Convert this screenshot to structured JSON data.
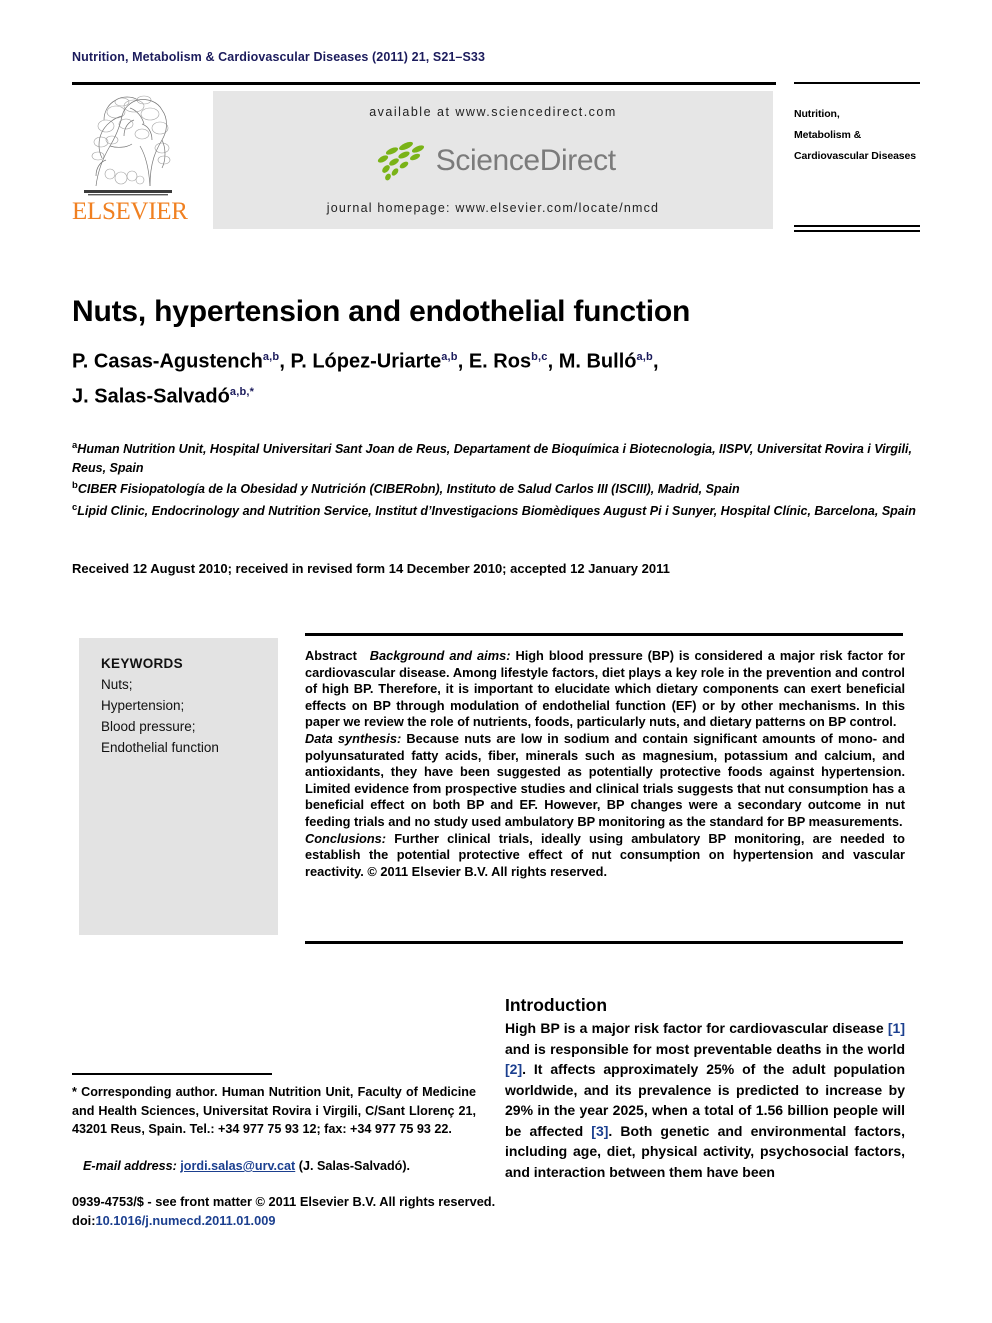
{
  "running_head": "Nutrition, Metabolism & Cardiovascular Diseases (2011) 21, S21–S33",
  "masthead": {
    "publisher_name": "ELSEVIER",
    "available_at": "available at www.sciencedirect.com",
    "sciencedirect_wordmark": "ScienceDirect",
    "journal_homepage": "journal homepage: www.elsevier.com/locate/nmcd",
    "journal_title_line1": "Nutrition,",
    "journal_title_line2": "Metabolism &",
    "journal_title_line3": "Cardiovascular Diseases",
    "colors": {
      "elsevier_orange": "#f08021",
      "sciencedirect_green": "#7ab317",
      "sciencedirect_grey": "#7b7b7b",
      "band_grey": "#e6e6e6"
    }
  },
  "article": {
    "title": "Nuts, hypertension and endothelial function",
    "authors_line1_parts": [
      {
        "name": "P. Casas-Agustench",
        "sup": "a,b",
        "sep": ", "
      },
      {
        "name": "P. López-Uriarte",
        "sup": "a,b",
        "sep": ", "
      },
      {
        "name": "E. Ros",
        "sup": "b,c",
        "sep": ", "
      },
      {
        "name": "M. Bulló",
        "sup": "a,b",
        "sep": ","
      }
    ],
    "authors_line2_parts": [
      {
        "name": "J. Salas-Salvadó",
        "sup": "a,b,*",
        "sep": ""
      }
    ],
    "affiliations": [
      {
        "mark": "a",
        "text": "Human Nutrition Unit, Hospital Universitari Sant Joan de Reus, Departament de Bioquímica i Biotecnologia, IISPV, Universitat Rovira i Virgili, Reus, Spain"
      },
      {
        "mark": "b",
        "text": "CIBER Fisiopatología de la Obesidad y Nutrición (CIBERobn), Instituto de Salud Carlos III (ISCIII), Madrid, Spain"
      },
      {
        "mark": "c",
        "text": "Lipid Clinic, Endocrinology and Nutrition Service, Institut d’Investigacions Biomèdiques August Pi i Sunyer, Hospital Clínic, Barcelona, Spain"
      }
    ],
    "history": "Received 12 August 2010; received in revised form 14 December 2010; accepted 12 January 2011"
  },
  "keywords": {
    "heading": "KEYWORDS",
    "items": [
      "Nuts;",
      "Hypertension;",
      "Blood pressure;",
      "Endothelial function"
    ]
  },
  "abstract": {
    "label": "Abstract",
    "sections": [
      {
        "head": "Background and aims:",
        "text": " High blood pressure (BP) is considered a major risk factor for cardiovascular disease. Among lifestyle factors, diet plays a key role in the prevention and control of high BP. Therefore, it is important to elucidate which dietary components can exert beneficial effects on BP through modulation of endothelial function (EF) or by other mechanisms. In this paper we review the role of nutrients, foods, particularly nuts, and dietary patterns on BP control."
      },
      {
        "head": "Data synthesis:",
        "text": " Because nuts are low in sodium and contain significant amounts of mono- and polyunsaturated fatty acids, fiber, minerals such as magnesium, potassium and calcium, and antioxidants, they have been suggested as potentially protective foods against hypertension. Limited evidence from prospective studies and clinical trials suggests that nut consumption has a beneficial effect on both BP and EF. However, BP changes were a secondary outcome in nut feeding trials and no study used ambulatory BP monitoring as the standard for BP measurements."
      },
      {
        "head": "Conclusions:",
        "text": " Further clinical trials, ideally using ambulatory BP monitoring, are needed to establish the potential protective effect of nut consumption on hypertension and vascular reactivity."
      }
    ],
    "copyright": "© 2011 Elsevier B.V. All rights reserved."
  },
  "introduction": {
    "heading": "Introduction",
    "body_segments": [
      {
        "type": "text",
        "value": "High BP is a major risk factor for cardiovascular disease "
      },
      {
        "type": "ref",
        "value": "[1]"
      },
      {
        "type": "text",
        "value": " and is responsible for most preventable deaths in the world "
      },
      {
        "type": "ref",
        "value": "[2]"
      },
      {
        "type": "text",
        "value": ". It affects approximately 25% of the adult population worldwide, and its prevalence is predicted to increase by 29% in the year 2025, when a total of 1.56 billion people will be affected "
      },
      {
        "type": "ref",
        "value": "[3]"
      },
      {
        "type": "text",
        "value": ". Both genetic and environmental factors, including age, diet, physical activity, psychosocial factors, and interaction between them have been"
      }
    ]
  },
  "footnote": {
    "corresponding": "* Corresponding author. Human Nutrition Unit, Faculty of Medicine and Health Sciences, Universitat Rovira i Virgili, C/Sant Llorenç 21, 43201 Reus, Spain. Tel.: +34 977 75 93 12; fax: +34 977 75 93 22.",
    "email_label": "E-mail address:",
    "email_address": "jordi.salas@urv.cat",
    "email_owner": "(J. Salas-Salvadó)."
  },
  "colophon": {
    "issn_line": "0939-4753/$ - see front matter © 2011 Elsevier B.V. All rights reserved.",
    "doi_prefix": "doi:",
    "doi_value": "10.1016/j.numecd.2011.01.009"
  }
}
